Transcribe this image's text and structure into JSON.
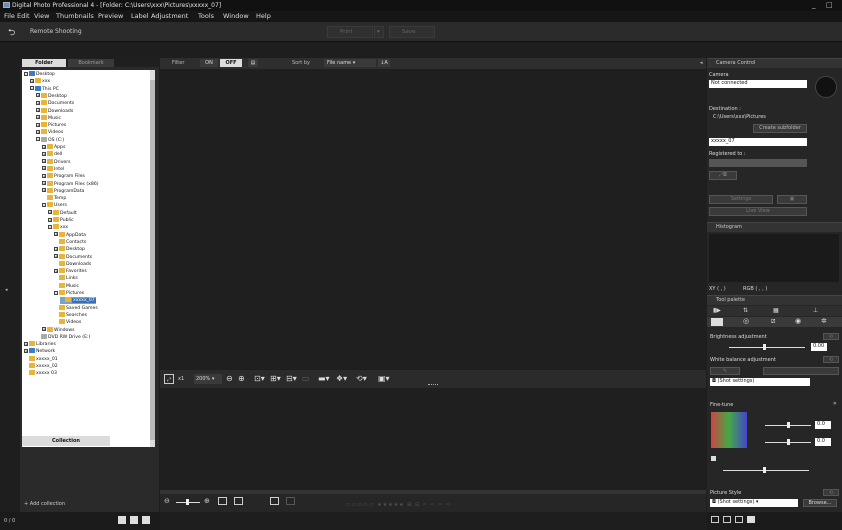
{
  "window": {
    "title": "Digital Photo Professional 4 - [Folder: C:\\Users\\xxx\\Pictures\\xxxxx_07]",
    "minimize": "_",
    "maximize": "□"
  },
  "menu": [
    "File",
    "Edit",
    "View",
    "Thumbnails",
    "Preview",
    "Label",
    "Adjustment",
    "Tools",
    "Window",
    "Help"
  ],
  "toolbar": {
    "remote_shooting": "Remote Shooting",
    "print": "Print",
    "save": "Save"
  },
  "left_panel": {
    "tabs": [
      "Folder",
      "Bookmark"
    ],
    "tree": [
      {
        "label": "Desktop",
        "depth": 0,
        "icon": "blue",
        "expander": "-"
      },
      {
        "label": "xxx",
        "depth": 1,
        "icon": "folder",
        "expander": "+"
      },
      {
        "label": "This PC",
        "depth": 1,
        "icon": "blue",
        "expander": "-"
      },
      {
        "label": "Desktop",
        "depth": 2,
        "icon": "folder",
        "expander": "+"
      },
      {
        "label": "Documents",
        "depth": 2,
        "icon": "folder",
        "expander": "+"
      },
      {
        "label": "Downloads",
        "depth": 2,
        "icon": "folder",
        "expander": "+"
      },
      {
        "label": "Music",
        "depth": 2,
        "icon": "folder",
        "expander": "+"
      },
      {
        "label": "Pictures",
        "depth": 2,
        "icon": "folder",
        "expander": "+"
      },
      {
        "label": "Videos",
        "depth": 2,
        "icon": "folder",
        "expander": "+"
      },
      {
        "label": "OS (C:)",
        "depth": 2,
        "icon": "gray",
        "expander": "-"
      },
      {
        "label": "Apps",
        "depth": 3,
        "icon": "folder",
        "expander": "+"
      },
      {
        "label": "dell",
        "depth": 3,
        "icon": "folder",
        "expander": "+"
      },
      {
        "label": "Drivers",
        "depth": 3,
        "icon": "folder",
        "expander": "+"
      },
      {
        "label": "Intel",
        "depth": 3,
        "icon": "folder",
        "expander": "+"
      },
      {
        "label": "Program Files",
        "depth": 3,
        "icon": "folder",
        "expander": "+"
      },
      {
        "label": "Program Files (x86)",
        "depth": 3,
        "icon": "folder",
        "expander": "+"
      },
      {
        "label": "ProgramData",
        "depth": 3,
        "icon": "folder",
        "expander": "+"
      },
      {
        "label": "Temp",
        "depth": 3,
        "icon": "folder",
        "expander": ""
      },
      {
        "label": "Users",
        "depth": 3,
        "icon": "folder",
        "expander": "-"
      },
      {
        "label": "Default",
        "depth": 4,
        "icon": "folder",
        "expander": "+"
      },
      {
        "label": "Public",
        "depth": 4,
        "icon": "folder",
        "expander": "+"
      },
      {
        "label": "xxx",
        "depth": 4,
        "icon": "folder",
        "expander": "-"
      },
      {
        "label": "AppData",
        "depth": 5,
        "icon": "folder",
        "expander": "+"
      },
      {
        "label": "Contacts",
        "depth": 5,
        "icon": "folder",
        "expander": ""
      },
      {
        "label": "Desktop",
        "depth": 5,
        "icon": "folder",
        "expander": "+"
      },
      {
        "label": "Documents",
        "depth": 5,
        "icon": "folder",
        "expander": "+"
      },
      {
        "label": "Downloads",
        "depth": 5,
        "icon": "folder",
        "expander": ""
      },
      {
        "label": "Favorites",
        "depth": 5,
        "icon": "folder",
        "expander": "+"
      },
      {
        "label": "Links",
        "depth": 5,
        "icon": "folder",
        "expander": ""
      },
      {
        "label": "Music",
        "depth": 5,
        "icon": "folder",
        "expander": ""
      },
      {
        "label": "Pictures",
        "depth": 5,
        "icon": "folder",
        "expander": "-"
      },
      {
        "label": "xxxxx_07",
        "depth": 6,
        "icon": "folder",
        "expander": "",
        "selected": true
      },
      {
        "label": "Saved Games",
        "depth": 5,
        "icon": "folder",
        "expander": ""
      },
      {
        "label": "Searches",
        "depth": 5,
        "icon": "folder",
        "expander": ""
      },
      {
        "label": "Videos",
        "depth": 5,
        "icon": "folder",
        "expander": ""
      },
      {
        "label": "Windows",
        "depth": 3,
        "icon": "folder",
        "expander": "+"
      },
      {
        "label": "DVD RW Drive (E:)",
        "depth": 2,
        "icon": "gray",
        "expander": ""
      },
      {
        "label": "Libraries",
        "depth": 0,
        "icon": "folder",
        "expander": "+"
      },
      {
        "label": "Network",
        "depth": 0,
        "icon": "blue",
        "expander": "+"
      },
      {
        "label": "xxxxx_01",
        "depth": 0,
        "icon": "folder",
        "expander": ""
      },
      {
        "label": "xxxxx_02",
        "depth": 0,
        "icon": "folder",
        "expander": ""
      },
      {
        "label": "xxxxx 03",
        "depth": 0,
        "icon": "folder",
        "expander": ""
      }
    ],
    "collection_tab": "Collection",
    "add_collection": "Add collection",
    "count": "0 / 0"
  },
  "main_header": {
    "filter_label": "Filter",
    "on": "ON",
    "off": "OFF",
    "sort_label": "Sort by",
    "sort_value": "File name"
  },
  "mid_toolbar": {
    "zoom_fit": "x1",
    "zoom_level": "200%"
  },
  "right_panel": {
    "camera_control": "Camera Control",
    "camera_label": "Camera",
    "camera_value": "Not connected",
    "destination_label": "Destination :",
    "destination_path": "C:\\Users\\xxx\\Pictures",
    "create_subfolder": "Create subfolder",
    "folder_value": "xxxxx_07",
    "registered_to": "Registered to :",
    "settings": "Settings",
    "live_view": "Live View",
    "histogram": "Histogram",
    "xy_readout": "XY (   ,   )",
    "rgb_readout": "RGB (   ,   ,   )",
    "tool_palette": "Tool palette",
    "brightness": "Brightness adjustment",
    "brightness_value": "0.00",
    "white_balance": "White balance adjustment",
    "shot_settings": "(Shot settings)",
    "fine_tune": "Fine-tune",
    "ft_value1": "0.0",
    "ft_value2": "0.0",
    "picture_style": "Picture Style",
    "picture_style_value": "(Shot settings)",
    "browse": "Browse..."
  }
}
